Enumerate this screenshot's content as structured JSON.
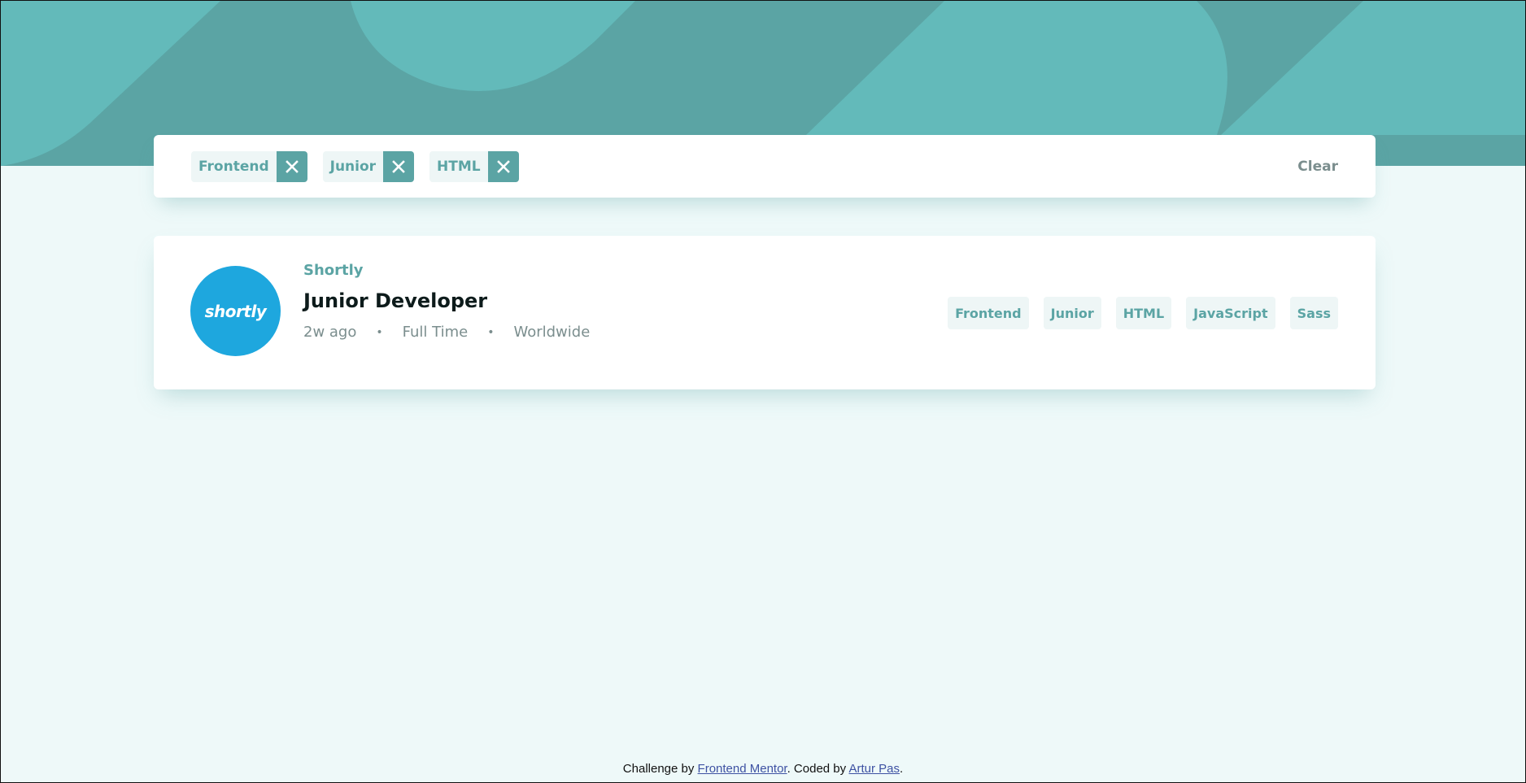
{
  "colors": {
    "primary": "#5ba4a4",
    "background": "#eef9f9",
    "tag_bg": "#eef6f6",
    "logo_bg": "#1ea7de"
  },
  "filter_bar": {
    "tags": [
      {
        "label": "Frontend"
      },
      {
        "label": "Junior"
      },
      {
        "label": "HTML"
      }
    ],
    "clear_label": "Clear"
  },
  "job": {
    "logo_text": "shortly",
    "company": "Shortly",
    "position": "Junior Developer",
    "posted_at": "2w ago",
    "contract": "Full Time",
    "location": "Worldwide",
    "separator": "•",
    "tags": [
      "Frontend",
      "Junior",
      "HTML",
      "JavaScript",
      "Sass"
    ]
  },
  "footer": {
    "prefix": "Challenge by ",
    "mentor_link": "Frontend Mentor",
    "middle": ". Coded by ",
    "author_link": "Artur Pas",
    "suffix": "."
  }
}
